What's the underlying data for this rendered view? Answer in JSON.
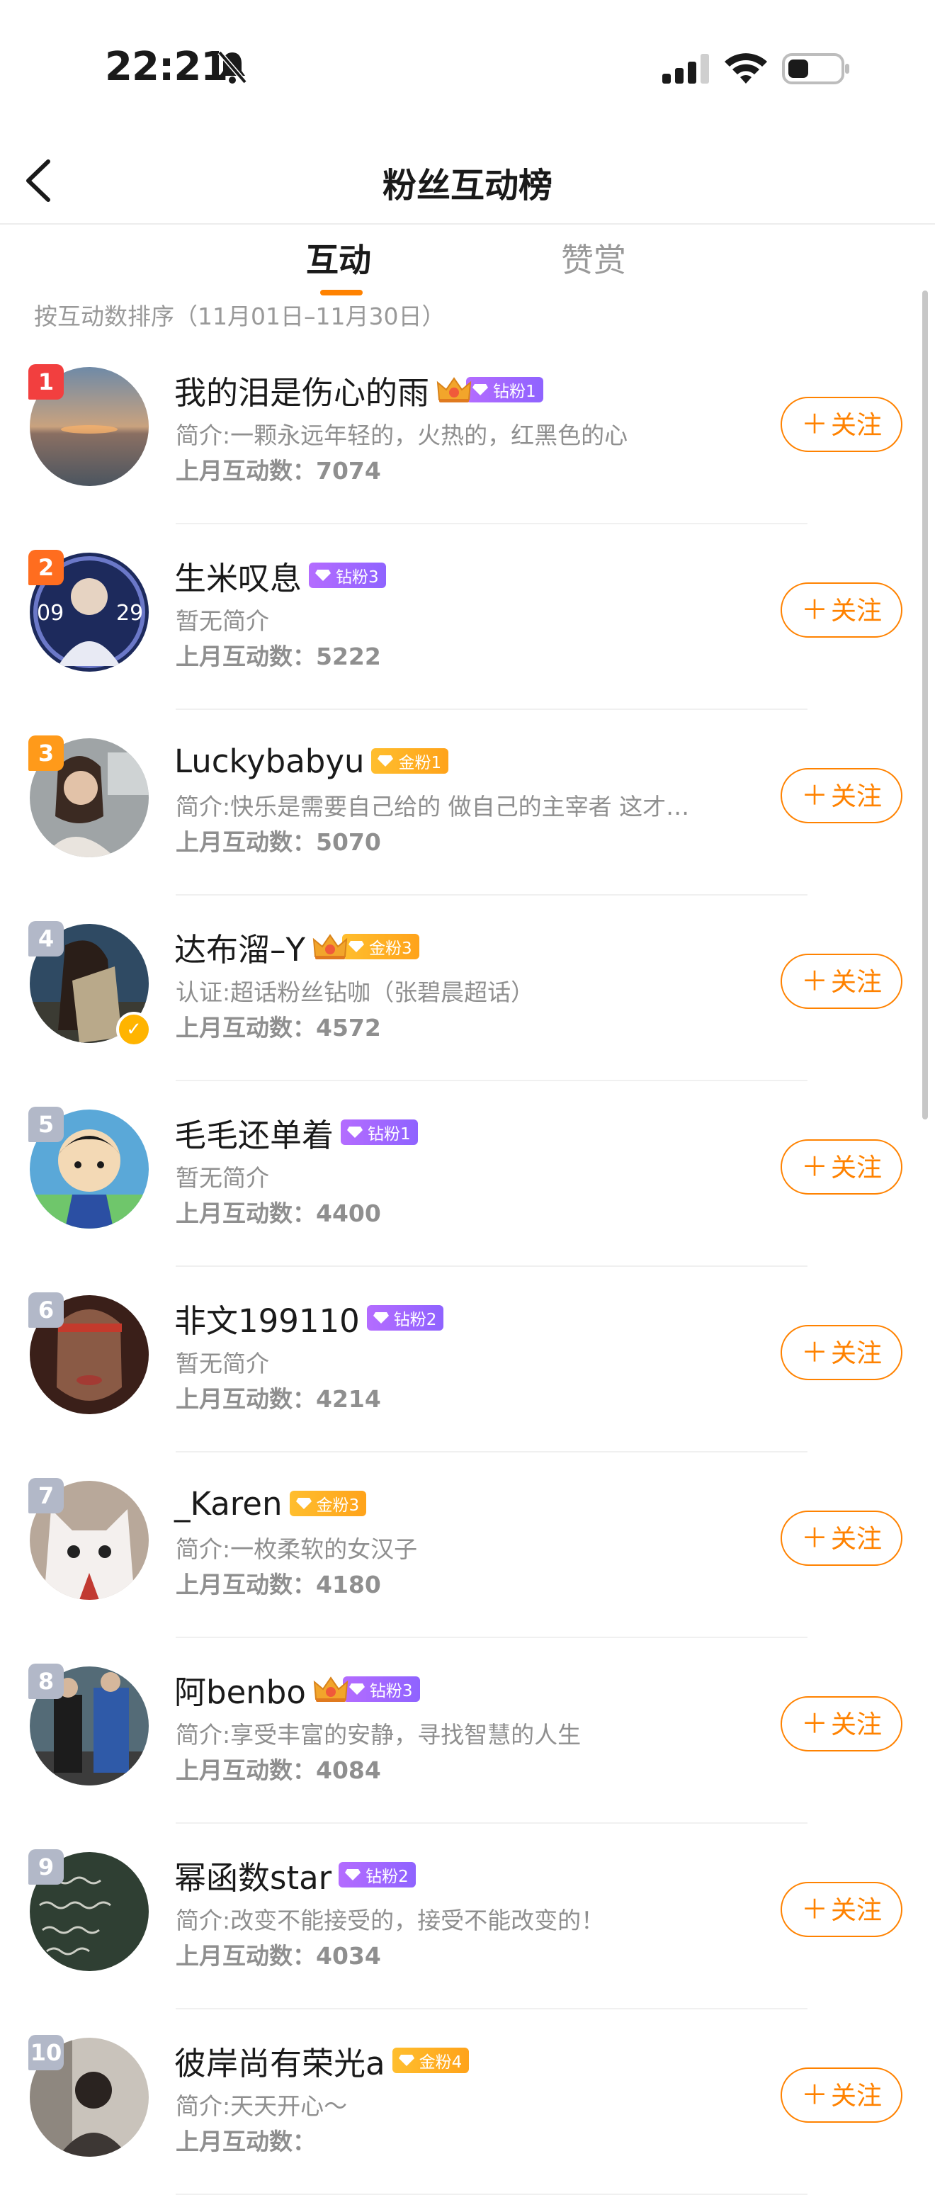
{
  "status_bar": {
    "time": "22:21",
    "icons": [
      "bell-off-icon",
      "signal-icon",
      "wifi-icon",
      "battery-icon"
    ]
  },
  "nav": {
    "title": "粉丝互动榜",
    "back_icon": "chevron-left-icon"
  },
  "tabs": [
    {
      "label": "互动",
      "active": true
    },
    {
      "label": "赞赏",
      "active": false
    }
  ],
  "sort_note": "按互动数排序（11月01日–11月30日）",
  "colors": {
    "accent": "#ff8200",
    "rank1": "#f23f3f",
    "rank2": "#ff6d1f",
    "rank3": "#ff9a1a",
    "rank_other": "#b2b8c8"
  },
  "fans": [
    {
      "rank": "1",
      "name": "我的泪是伤心的雨",
      "crown": true,
      "badge": "钻粉1",
      "badge_type": "diamond",
      "intro": "简介:一颗永远年轻的，火热的，红黑色的心",
      "count": "上月互动数：7074",
      "follow": "关注",
      "avatar": "sunset-sea"
    },
    {
      "rank": "2",
      "name": "生米叹息",
      "crown": false,
      "badge": "钻粉3",
      "badge_type": "diamond",
      "intro": "暂无简介",
      "count": "上月互动数：5222",
      "follow": "关注",
      "avatar": "portrait-blue"
    },
    {
      "rank": "3",
      "name": "Luckybabyu",
      "crown": false,
      "badge": "金粉1",
      "badge_type": "gold",
      "intro": "简介:快乐是需要自己给的 做自己的主宰者 这才…",
      "count": "上月互动数：5070",
      "follow": "关注",
      "avatar": "woman-car"
    },
    {
      "rank": "4",
      "name": "达布溜–Y",
      "crown": true,
      "badge": "金粉3",
      "badge_type": "gold",
      "intro": "认证:超话粉丝钻咖（张碧晨超话）",
      "count": "上月互动数：4572",
      "follow": "关注",
      "avatar": "person-outdoor",
      "verified": true
    },
    {
      "rank": "5",
      "name": "毛毛还单着",
      "crown": false,
      "badge": "钻粉1",
      "badge_type": "diamond",
      "intro": "暂无简介",
      "count": "上月互动数：4400",
      "follow": "关注",
      "avatar": "cartoon-boy"
    },
    {
      "rank": "6",
      "name": "非文199110",
      "crown": false,
      "badge": "钻粉2",
      "badge_type": "diamond",
      "intro": "暂无简介",
      "count": "上月互动数：4214",
      "follow": "关注",
      "avatar": "face-dark"
    },
    {
      "rank": "7",
      "name": "_Karen",
      "crown": false,
      "badge": "金粉3",
      "badge_type": "gold",
      "intro": "简介:一枚柔软的女汉子",
      "count": "上月互动数：4180",
      "follow": "关注",
      "avatar": "white-cat"
    },
    {
      "rank": "8",
      "name": "阿benbo",
      "crown": true,
      "badge": "钻粉3",
      "badge_type": "diamond",
      "intro": "简介:享受丰富的安静，寻找智慧的人生",
      "count": "上月互动数：4084",
      "follow": "关注",
      "avatar": "street-people"
    },
    {
      "rank": "9",
      "name": "幂函数star",
      "crown": false,
      "badge": "钻粉2",
      "badge_type": "diamond",
      "intro": "简介:改变不能接受的，接受不能改变的！",
      "count": "上月互动数：4034",
      "follow": "关注",
      "avatar": "chalkboard"
    },
    {
      "rank": "10",
      "name": "彼岸尚有荣光a",
      "crown": false,
      "badge": "金粉4",
      "badge_type": "gold",
      "intro": "简介:天天开心～",
      "count": "上月互动数：",
      "follow": "关注",
      "avatar": "person-room"
    }
  ]
}
